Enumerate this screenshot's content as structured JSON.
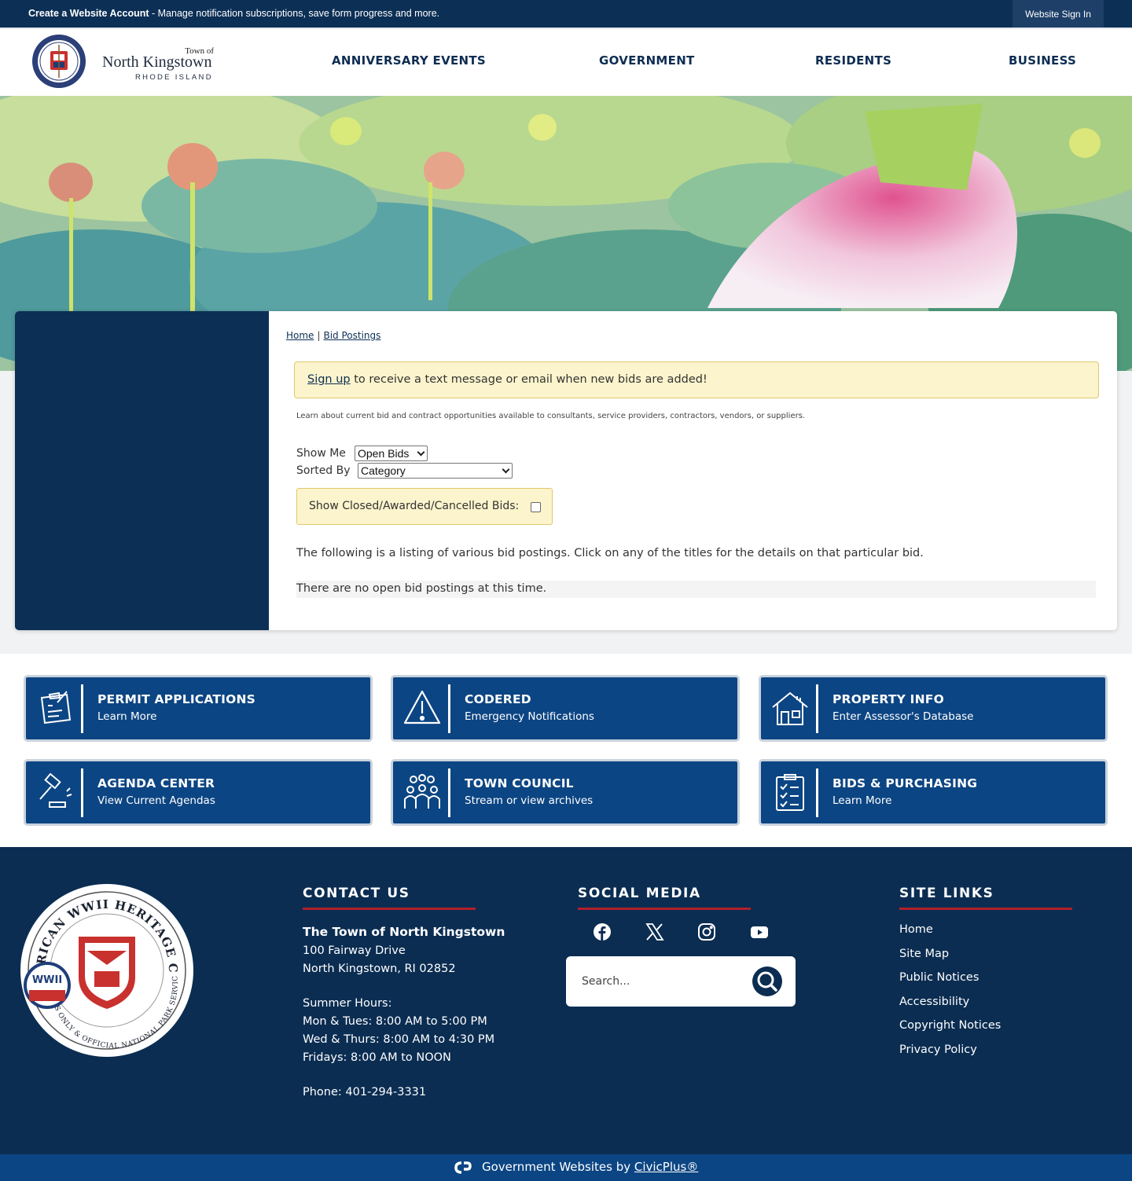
{
  "topbar": {
    "account_bold": "Create a Website Account",
    "account_rest": " - Manage notification subscriptions, save form progress and more.",
    "signin": "Website Sign In"
  },
  "logo": {
    "town_of": "Town of",
    "name": "North Kingstown",
    "state": "RHODE ISLAND"
  },
  "nav": [
    "ANNIVERSARY EVENTS",
    "GOVERNMENT",
    "RESIDENTS",
    "BUSINESS"
  ],
  "breadcrumb": {
    "home": "Home",
    "sep": "|",
    "current": "Bid Postings"
  },
  "signup": {
    "link": "Sign up",
    "text": " to receive a text message or email when new bids are added!"
  },
  "intro": "Learn about current bid and contract opportunities available to consultants, service providers, contractors, vendors, or suppliers.",
  "filters": {
    "show_me_label": "Show Me",
    "show_me_value": "Open Bids",
    "sorted_by_label": "Sorted By",
    "sorted_by_value": "Category",
    "closed_label": "Show Closed/Awarded/Cancelled Bids:"
  },
  "listing_text": "The following is a listing of various bid postings. Click on any of the titles for the details on that particular bid.",
  "no_bids": "There are no open bid postings at this time.",
  "quick_links": [
    {
      "title": "PERMIT APPLICATIONS",
      "sub": "Learn More",
      "icon": "clipboard-icon"
    },
    {
      "title": "CODERED",
      "sub": "Emergency Notifications",
      "icon": "warning-icon"
    },
    {
      "title": "PROPERTY INFO",
      "sub": "Enter Assessor's Database",
      "icon": "house-icon"
    },
    {
      "title": "AGENDA CENTER",
      "sub": "View Current Agendas",
      "icon": "gavel-icon"
    },
    {
      "title": "TOWN COUNCIL",
      "sub": "Stream or view archives",
      "icon": "people-icon"
    },
    {
      "title": "BIDS & PURCHASING",
      "sub": "Learn More",
      "icon": "checklist-icon"
    }
  ],
  "footer": {
    "contact_heading": "CONTACT US",
    "org": "The Town of North Kingstown",
    "address1": "100 Fairway Drive",
    "address2": "North Kingstown, RI 02852",
    "hours_title": "Summer Hours:",
    "hours1": "Mon & Tues: 8:00 AM to 5:00 PM",
    "hours2": "Wed & Thurs: 8:00 AM to 4:30 PM",
    "hours3": "Fridays: 8:00 AM to NOON",
    "phone": "Phone: 401-294-3331",
    "social_heading": "SOCIAL MEDIA",
    "search_placeholder": "Search...",
    "site_links_heading": "SITE LINKS",
    "site_links": [
      "Home",
      "Site Map",
      "Public Notices",
      "Accessibility",
      "Copyright Notices",
      "Privacy Policy"
    ],
    "seal_text_top": "AMERICAN WWII HERITAGE CITY",
    "seal_text_bottom": "RHODE ISLAND'S ONLY & OFFICIAL NATIONAL PARK SERVICE DESIGNEE"
  },
  "bottom": {
    "prefix": "Government Websites by ",
    "link": "CivicPlus®"
  },
  "colors": {
    "navy": "#0c2f55",
    "button_blue": "#0c4583",
    "accent_red": "#b21f2a",
    "notice_yellow": "#fcf4cc"
  }
}
